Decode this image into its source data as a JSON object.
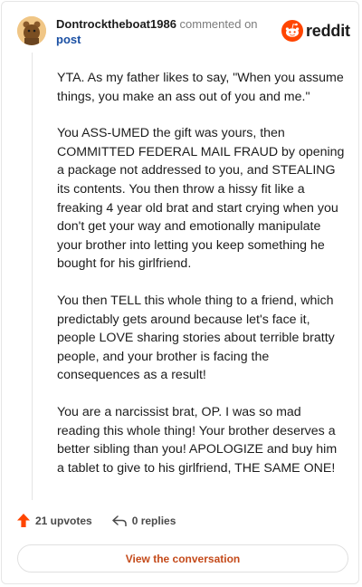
{
  "comment": {
    "username": "Dontrocktheboat1986",
    "action_text": "commented on",
    "post_link": "post",
    "paragraphs": [
      "YTA. As my father likes to say, \"When you assume things, you make an ass out of you and me.\"",
      "You ASS-UMED the gift was yours, then COMMITTED FEDERAL MAIL FRAUD by opening a package not addressed to you, and STEALING its contents. You then throw a hissy fit like a freaking 4 year old brat and start crying when you don't get your way and emotionally manipulate your brother into letting you keep something he bought for his girlfriend.",
      "You then TELL this whole thing to a friend, which predictably gets around because let's face it, people LOVE sharing stories about terrible bratty people, and your brother is facing the consequences as a result!",
      "You are a narcissist brat, OP. I was so mad reading this whole thing! Your brother deserves a better sibling than you! APOLOGIZE and buy him a tablet to give to his girlfriend, THE SAME ONE!"
    ],
    "upvotes_label": "21 upvotes",
    "replies_label": "0 replies"
  },
  "brand": {
    "name": "reddit",
    "logo_icon": "reddit-snoo-icon",
    "accent": "#ff4500"
  },
  "footer": {
    "view_conversation": "View the conversation"
  },
  "colors": {
    "upvote": "#ff4500",
    "link": "#1a4fa3",
    "button_text": "#c44a1a"
  }
}
